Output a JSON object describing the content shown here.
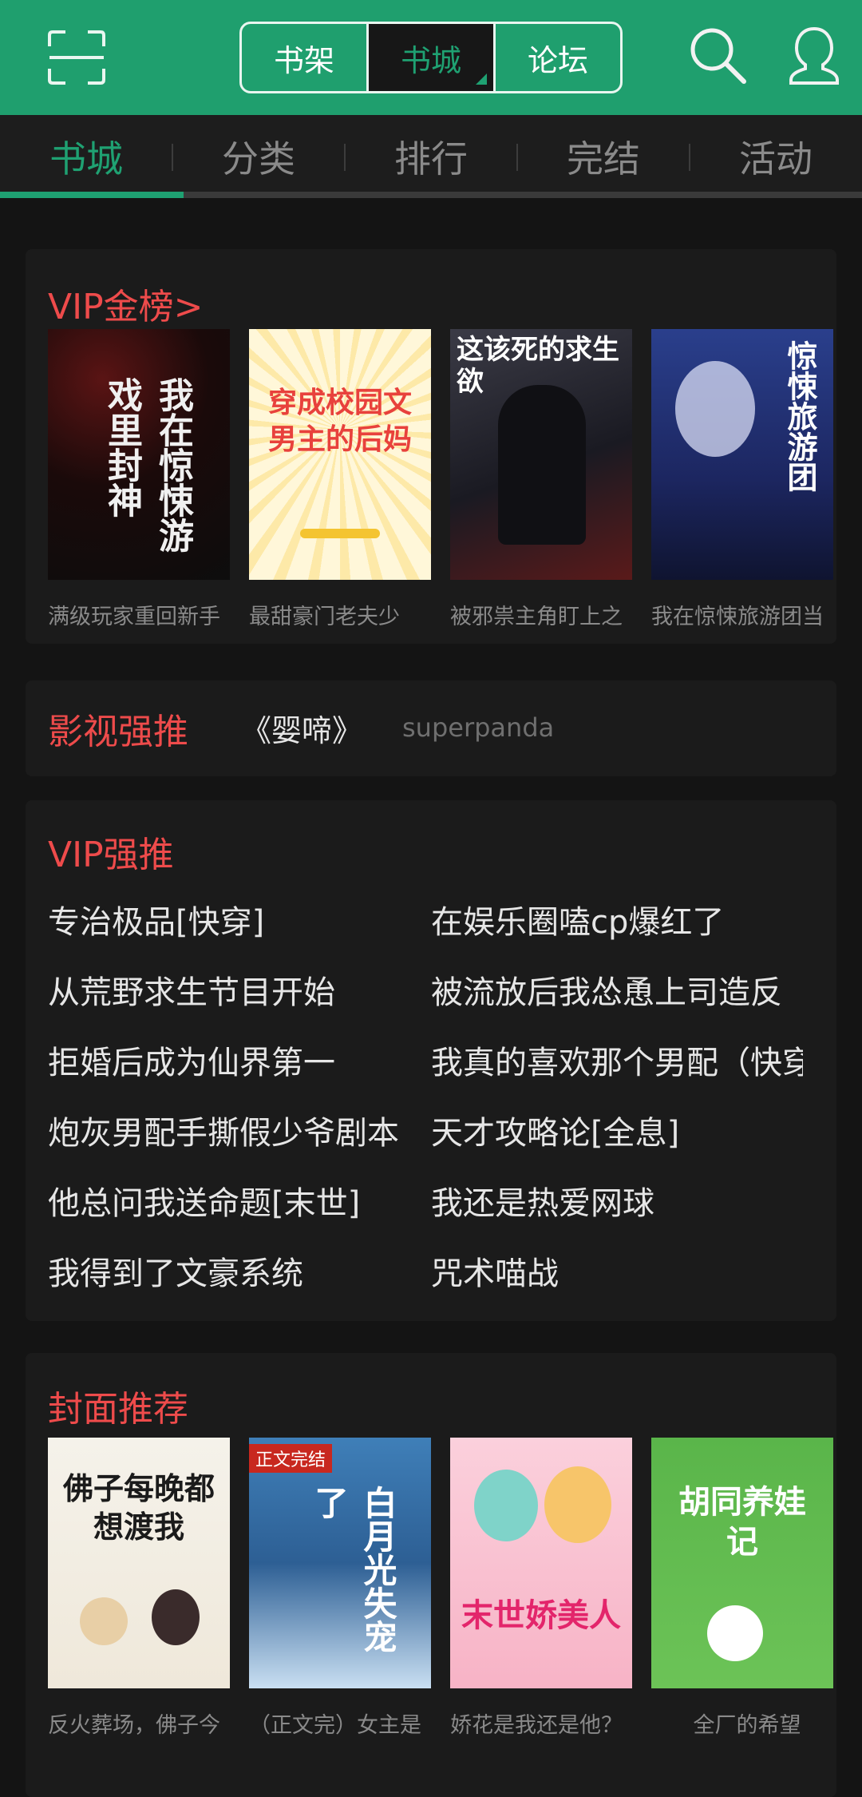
{
  "header": {
    "segments": [
      {
        "label": "书架",
        "active": false
      },
      {
        "label": "书城",
        "active": true
      },
      {
        "label": "论坛",
        "active": false
      }
    ],
    "icons": {
      "scan": "scan-icon",
      "search": "search-icon",
      "user": "user-icon"
    },
    "colors": {
      "brand": "#1fa172",
      "header_bg": "#1f9f6e",
      "accent_red": "#ee4b4b"
    }
  },
  "tabs": [
    {
      "label": "书城",
      "active": true
    },
    {
      "label": "分类",
      "active": false
    },
    {
      "label": "排行",
      "active": false
    },
    {
      "label": "完结",
      "active": false
    },
    {
      "label": "活动",
      "active": false
    }
  ],
  "vip_gold": {
    "title": "VIP金榜>",
    "books": [
      {
        "desc": "满级玩家重回新手",
        "cover_text": "我在惊悚游戏里封神"
      },
      {
        "desc": "最甜豪门老夫少",
        "cover_text": "穿成校园文男主的后妈"
      },
      {
        "desc": "被邪祟主角盯上之",
        "cover_text": "这该死的求生欲"
      },
      {
        "desc": "我在惊悚旅游团当",
        "cover_text": "惊悚旅游团"
      }
    ]
  },
  "film": {
    "label": "影视强推",
    "title": "《婴啼》",
    "author": "superpanda"
  },
  "vip_push": {
    "title": "VIP强推",
    "left": [
      "专治极品[快穿]",
      "从荒野求生节目开始",
      "拒婚后成为仙界第一",
      "炮灰男配手撕假少爷剧本",
      "他总问我送命题[末世]",
      "我得到了文豪系统"
    ],
    "right": [
      "在娱乐圈嗑cp爆红了",
      "被流放后我怂恿上司造反",
      "我真的喜欢那个男配（快穿）",
      "天才攻略论[全息]",
      "我还是热爱网球",
      "咒术喵战"
    ]
  },
  "cover_rec": {
    "title": "封面推荐",
    "books": [
      {
        "desc": "反火葬场，佛子今",
        "cover_text": "佛子每晚都想渡我"
      },
      {
        "desc": "（正文完）女主是",
        "cover_text": "白月光失宠了",
        "badge": "正文完结"
      },
      {
        "desc": "娇花是我还是他？",
        "cover_text": "末世娇美人"
      },
      {
        "desc": "全厂的希望",
        "cover_text": "胡同养娃记"
      }
    ]
  }
}
